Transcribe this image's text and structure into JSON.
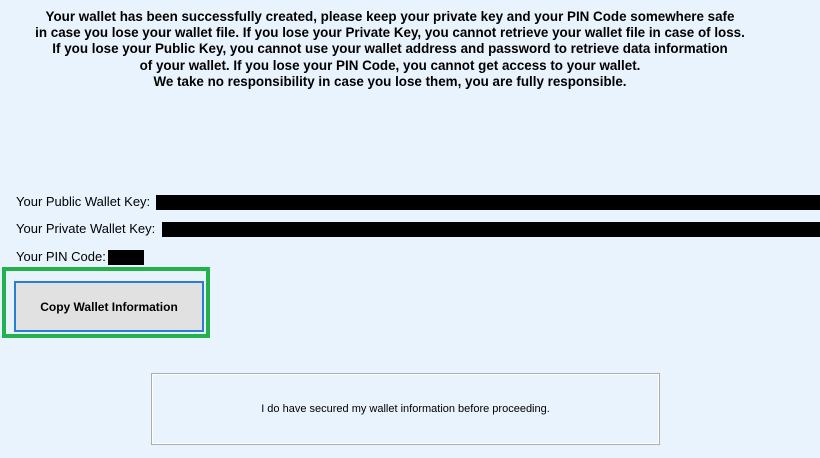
{
  "warning": {
    "lines": [
      "Your wallet has been successfully created, please keep your private key and your PIN Code somewhere safe",
      "in case you lose your wallet file. If you lose your Private Key, you cannot retrieve your wallet file in case of loss.",
      "If you lose your Public Key, you cannot use your wallet address and password to retrieve data information",
      "of your wallet. If you lose your PIN Code, you cannot get access to your wallet.",
      "We take no responsibility in case you lose them, you are fully responsible."
    ]
  },
  "wallet_info": {
    "public_key_label": "Your Public Wallet Key:",
    "private_key_label": "Your Private Wallet Key:",
    "pin_code_label": "Your PIN Code:"
  },
  "buttons": {
    "copy_label": "Copy Wallet Information",
    "confirm_label": "I do have secured my wallet information before proceeding."
  },
  "colors": {
    "background": "#e9f3fd",
    "highlight": "#22b14c",
    "button_focus_border": "#2b7cd3",
    "redaction": "#000000"
  }
}
